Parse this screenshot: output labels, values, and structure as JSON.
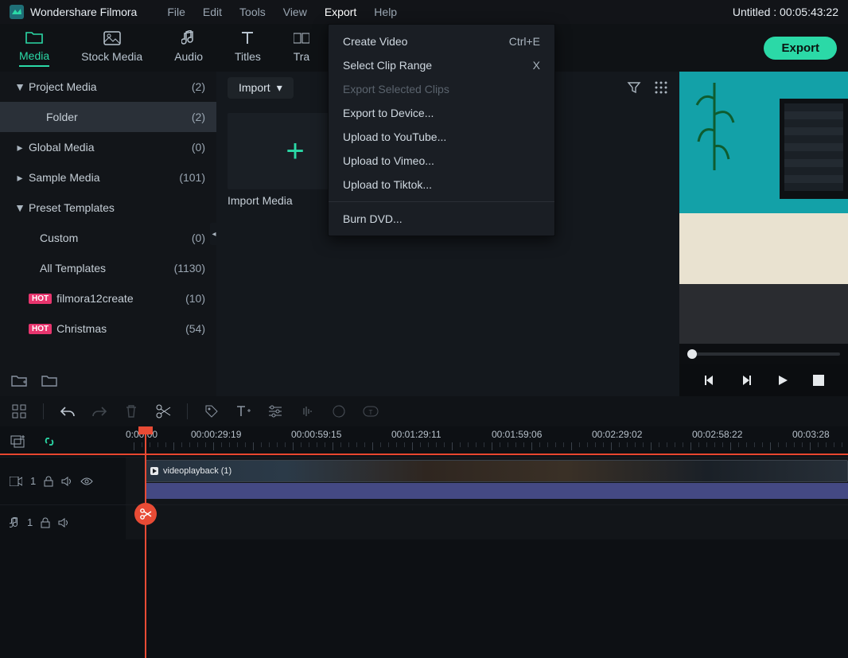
{
  "app": {
    "name": "Wondershare Filmora",
    "document_title": "Untitled : 00:05:43:22"
  },
  "menubar": [
    "File",
    "Edit",
    "Tools",
    "View",
    "Export",
    "Help"
  ],
  "menubar_active": "Export",
  "tabs": [
    {
      "label": "Media",
      "active": true
    },
    {
      "label": "Stock Media"
    },
    {
      "label": "Audio"
    },
    {
      "label": "Titles"
    },
    {
      "label": "Tra"
    }
  ],
  "export_button": "Export",
  "import_button": "Import",
  "sidebar": [
    {
      "label": "Project Media",
      "count": "(2)",
      "expanded": true,
      "level": 0
    },
    {
      "label": "Folder",
      "count": "(2)",
      "level": 1,
      "selected": true
    },
    {
      "label": "Global Media",
      "count": "(0)",
      "expandable": true,
      "level": 0
    },
    {
      "label": "Sample Media",
      "count": "(101)",
      "expandable": true,
      "level": 0
    },
    {
      "label": "Preset Templates",
      "count": "",
      "expanded": true,
      "level": 0
    },
    {
      "label": "Custom",
      "count": "(0)",
      "level": 1
    },
    {
      "label": "All Templates",
      "count": "(1130)",
      "level": 1
    },
    {
      "label": "filmora12create",
      "count": "(10)",
      "level": 1,
      "hot": true
    },
    {
      "label": "Christmas",
      "count": "(54)",
      "level": 1,
      "hot": true
    }
  ],
  "media": {
    "import_tile_label": "Import Media",
    "clip1_label": "videoplayback (1)"
  },
  "export_menu": [
    {
      "label": "Create Video",
      "shortcut": "Ctrl+E"
    },
    {
      "label": "Select Clip Range",
      "shortcut": "X"
    },
    {
      "label": "Export Selected Clips",
      "disabled": true
    },
    {
      "label": "Export to Device..."
    },
    {
      "label": "Upload to YouTube..."
    },
    {
      "label": "Upload to Vimeo..."
    },
    {
      "label": "Upload to Tiktok..."
    },
    {
      "sep": true
    },
    {
      "label": "Burn DVD..."
    }
  ],
  "ruler": {
    "start": "0:00:00",
    "marks": [
      "00:00:29:19",
      "00:00:59:15",
      "00:01:29:11",
      "00:01:59:06",
      "00:02:29:02",
      "00:02:58:22",
      "00:03:28"
    ]
  },
  "timeline_clip_label": "videoplayback (1)",
  "icons": {
    "filter": "filter-icon",
    "grid": "grid-icon",
    "undo": "undo-icon",
    "redo": "redo-icon",
    "trash": "trash-icon",
    "scissors": "scissors-icon",
    "tag": "tag-icon",
    "text": "text-add-icon",
    "sliders": "sliders-icon",
    "audio": "audio-icon",
    "cc": "color-icon",
    "tc": "timecode-icon",
    "apps": "apps-icon",
    "marker": "marker-icon",
    "link": "link-icon",
    "prev": "prev-frame-icon",
    "next": "next-frame-icon",
    "play": "play-icon",
    "stop": "stop-icon"
  },
  "track_labels": {
    "video": "1",
    "audio": "1"
  }
}
